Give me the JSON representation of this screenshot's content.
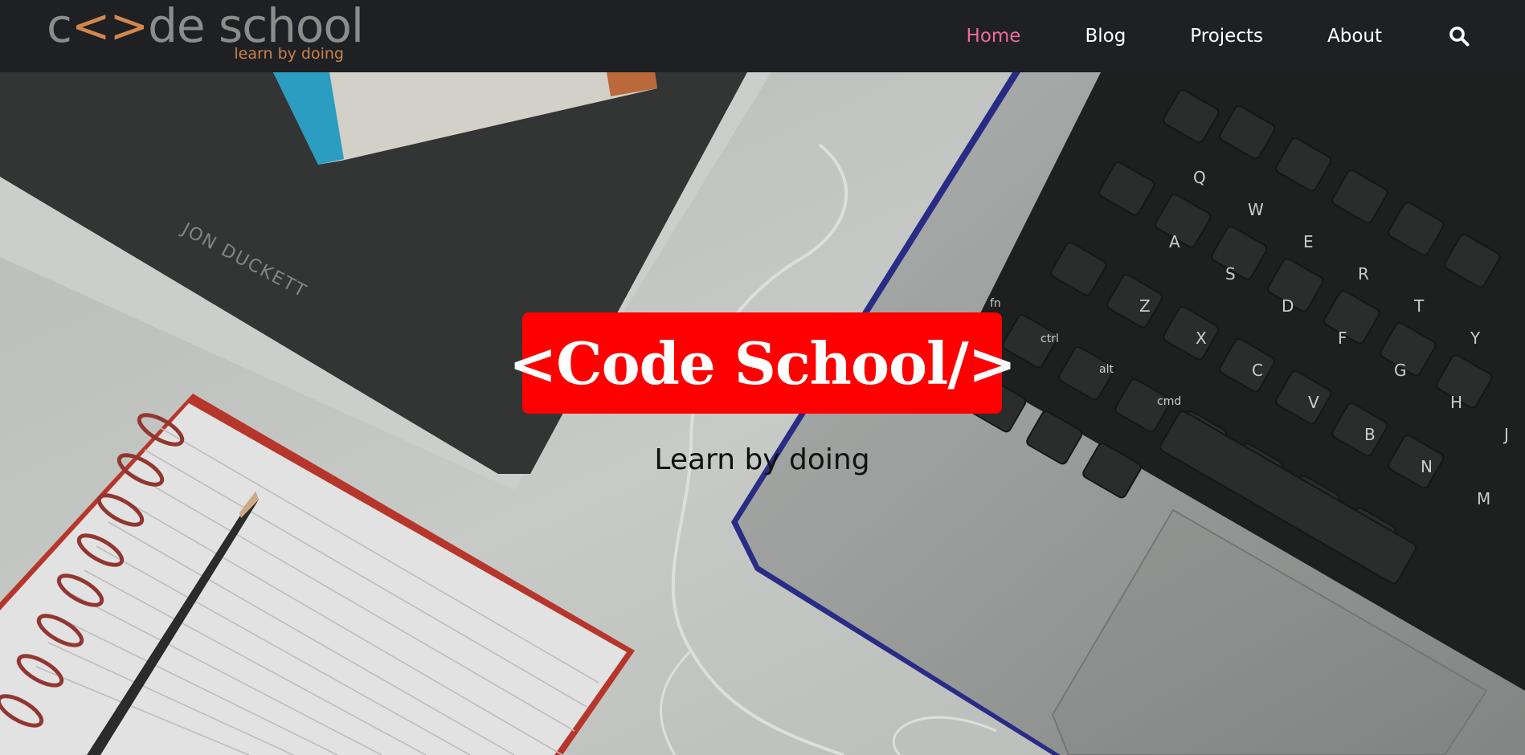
{
  "logo": {
    "brand_start": "c",
    "brand_bracket": "<>",
    "brand_end": "de school",
    "tagline": "learn by doing",
    "text_color": "#8a8d8a",
    "accent_color": "#d2884d"
  },
  "nav": {
    "items": [
      {
        "label": "Home",
        "active": true
      },
      {
        "label": "Blog",
        "active": false
      },
      {
        "label": "Projects",
        "active": false
      },
      {
        "label": "About",
        "active": false
      }
    ],
    "search_icon": "search-icon",
    "active_color": "#f06a9b"
  },
  "hero": {
    "title": "<Code School/>",
    "subtitle": "Learn by doing",
    "title_bg_color": "#ff0000",
    "book_text": "JON DUCKETT",
    "keyboard_keys": [
      "Q",
      "W",
      "E",
      "R",
      "T",
      "Y",
      "A",
      "S",
      "D",
      "F",
      "G",
      "H",
      "J",
      "Z",
      "X",
      "C",
      "V",
      "B",
      "N",
      "M"
    ],
    "modifier_keys": [
      "fn",
      "ctrl",
      "alt",
      "cmd"
    ]
  }
}
